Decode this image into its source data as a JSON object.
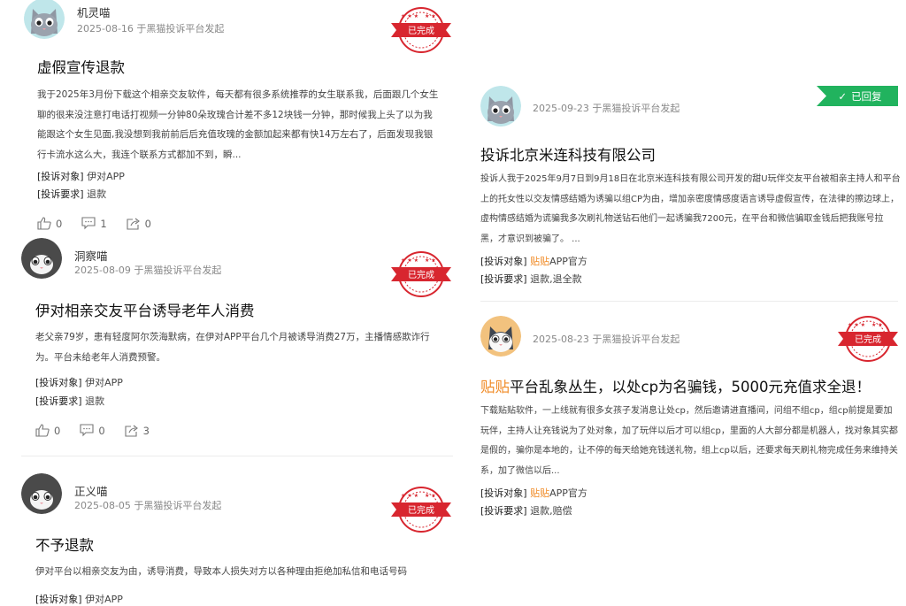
{
  "colors": {
    "accent": "#f08a24",
    "stamp_red": "#d8262f",
    "replied_green": "#21b35e"
  },
  "status": {
    "done": "已完成",
    "replied": "已回复"
  },
  "left": [
    {
      "username": "机灵喵",
      "meta": "2025-08-16 于黑猫投诉平台发起",
      "title": "虚假宣传退款",
      "body": "我于2025年3月份下载这个相亲交友软件，每天都有很多系统推荐的女生联系我，后面跟几个女生聊的很来没注意打电话打视频一分钟80朵玫瑰合计差不多12块钱一分钟，那时候我上头了以为我能跟这个女生见面,我没想到我前前后后充值玫瑰的金额加起来都有快14万左右了，后面发现我银行卡流水这么大，我连个联系方式都加不到，瞬...",
      "target_label": "[投诉对象]",
      "target": "伊对APP",
      "demand_label": "[投诉要求]",
      "demand": "退款",
      "likes": "0",
      "comments": "1",
      "shares": "0"
    },
    {
      "username": "洞察喵",
      "meta": "2025-08-09 于黑猫投诉平台发起",
      "title": "伊对相亲交友平台诱导老年人消费",
      "body": "老父亲79岁，患有轻度阿尔茨海默病，在伊对APP平台几个月被诱导消费27万，主播情感欺诈行为。平台未给老年人消费预警。",
      "target_label": "[投诉对象]",
      "target": "伊对APP",
      "demand_label": "[投诉要求]",
      "demand": "退款",
      "likes": "0",
      "comments": "0",
      "shares": "3"
    },
    {
      "username": "正义喵",
      "meta": "2025-08-05 于黑猫投诉平台发起",
      "title": "不予退款",
      "body": "伊对平台以相亲交友为由，诱导消费，导致本人损失对方以各种理由拒绝加私信和电话号码",
      "target_label": "[投诉对象]",
      "target": "伊对APP"
    }
  ],
  "right": [
    {
      "meta": "2025-09-23 于黑猫投诉平台发起",
      "title": "投诉北京米连科技有限公司",
      "body": "投诉人我于2025年9月7日到9月18日在北京米连科技有限公司开发的甜U玩伴交友平台被相亲主持人和平台上的托女性以交友情感结婚为诱骗以组CP为由，增加亲密度情感度语言诱导虚假宣传，在法律的擦边球上，虚构情感结婚为谎骗我多次刷礼物送钻石他们一起诱骗我7200元，在平台和微信骗取金钱后把我账号拉黑，才意识到被骗了。 ...",
      "target_label": "[投诉对象]",
      "target_hl": "贴贴",
      "target_rest": "APP官方",
      "demand_label": "[投诉要求]",
      "demand": "退款,退全款"
    },
    {
      "meta": "2025-08-23 于黑猫投诉平台发起",
      "title_hl": "贴贴",
      "title_rest": "平台乱象丛生，以处cp为名骗钱，5000元充值求全退！",
      "body": "下载贴贴软件，一上线就有很多女孩子发消息让处cp，然后邀请进直播间，问组不组cp，组cp前提是要加玩伴，主持人让充钱说为了处对象，加了玩伴以后才可以组cp，里面的人大部分都是机器人，找对象其实都是假的，骗你是本地的，让不停的每天给她充钱送礼物，组上cp以后，还要求每天刷礼物完成任务来维持关系，加了微信以后...",
      "target_label": "[投诉对象]",
      "target_hl": "贴贴",
      "target_rest": "APP官方",
      "demand_label": "[投诉要求]",
      "demand": "退款,赔偿"
    }
  ]
}
